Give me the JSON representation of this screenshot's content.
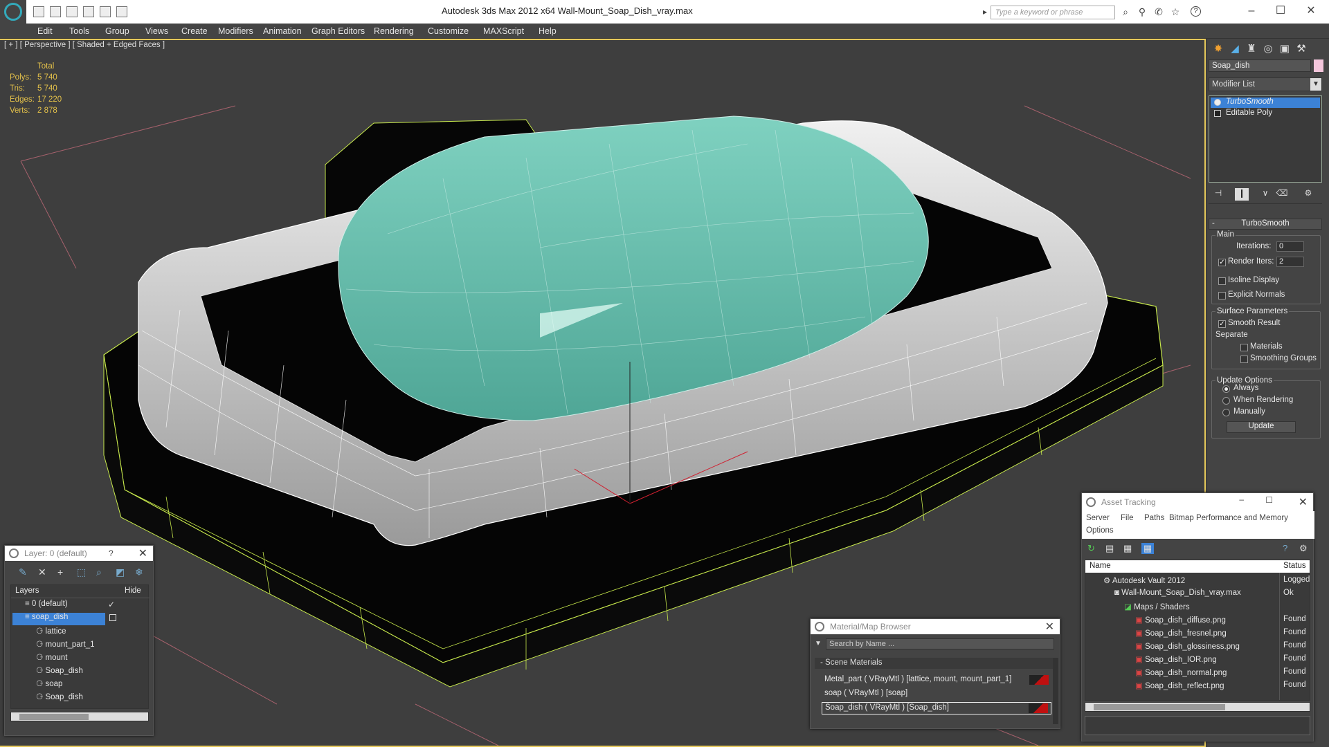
{
  "window": {
    "title": "Autodesk 3ds Max  2012 x64       Wall-Mount_Soap_Dish_vray.max",
    "search_placeholder": "Type a keyword or phrase",
    "help_icon": "?"
  },
  "menu": [
    "Edit",
    "Tools",
    "Group",
    "Views",
    "Create",
    "Modifiers",
    "Animation",
    "Graph Editors",
    "Rendering",
    "Customize",
    "MAXScript",
    "Help"
  ],
  "viewport": {
    "label": "[ + ] [ Perspective ] [ Shaded + Edged Faces ]",
    "stats": {
      "header": "Total",
      "rows": [
        {
          "label": "Polys:",
          "value": "5 740"
        },
        {
          "label": "Tris:",
          "value": "5 740"
        },
        {
          "label": "Edges:",
          "value": "17 220"
        },
        {
          "label": "Verts:",
          "value": "2 878"
        }
      ]
    }
  },
  "command_panel": {
    "object_name": "Soap_dish",
    "object_color": "#f4c6dc",
    "modifier_list": "Modifier List",
    "stack": [
      "TurboSmooth",
      "Editable Poly"
    ],
    "rollout": {
      "title": "TurboSmooth",
      "main": "Main",
      "iterations_label": "Iterations:",
      "iterations_value": "0",
      "render_iters_label": "Render Iters:",
      "render_iters_value": "2",
      "isoline": "Isoline Display",
      "explicit_normals": "Explicit Normals",
      "surface_params": "Surface Parameters",
      "smooth_result": "Smooth Result",
      "separate": "Separate",
      "materials": "Materials",
      "smoothing_groups": "Smoothing Groups",
      "update_options": "Update Options",
      "always": "Always",
      "when_rendering": "When Rendering",
      "manually": "Manually",
      "update_button": "Update"
    }
  },
  "layer_panel": {
    "title": "Layer: 0 (default)",
    "help": "?",
    "col_layers": "Layers",
    "col_hide": "Hide",
    "items": [
      {
        "name": "0 (default)",
        "indent": 1
      },
      {
        "name": "soap_dish",
        "indent": 1,
        "selected": true
      },
      {
        "name": "lattice",
        "indent": 2
      },
      {
        "name": "mount_part_1",
        "indent": 2
      },
      {
        "name": "mount",
        "indent": 2
      },
      {
        "name": "Soap_dish",
        "indent": 2
      },
      {
        "name": "soap",
        "indent": 2
      },
      {
        "name": "Soap_dish",
        "indent": 2
      }
    ]
  },
  "material_browser": {
    "title": "Material/Map Browser",
    "search": "Search by Name ...",
    "section": "Scene Materials",
    "items": [
      "Metal_part  ( VRayMtl )  [lattice, mount, mount_part_1]",
      "soap  ( VRayMtl )  [soap]",
      "Soap_dish  ( VRayMtl )  [Soap_dish]"
    ]
  },
  "asset_tracking": {
    "title": "Asset Tracking",
    "menu": [
      "Server",
      "File",
      "Paths",
      "Bitmap Performance and Memory"
    ],
    "menu2": "Options",
    "col_name": "Name",
    "col_status": "Status",
    "rows": [
      {
        "name": "Autodesk Vault 2012",
        "status": "Logged Out",
        "indent": 1
      },
      {
        "name": "Wall-Mount_Soap_Dish_vray.max",
        "status": "Ok",
        "indent": 2
      },
      {
        "name": "Maps / Shaders",
        "status": "",
        "indent": 3
      },
      {
        "name": "Soap_dish_diffuse.png",
        "status": "Found",
        "indent": 4
      },
      {
        "name": "Soap_dish_fresnel.png",
        "status": "Found",
        "indent": 4
      },
      {
        "name": "Soap_dish_glossiness.png",
        "status": "Found",
        "indent": 4
      },
      {
        "name": "Soap_dish_IOR.png",
        "status": "Found",
        "indent": 4
      },
      {
        "name": "Soap_dish_normal.png",
        "status": "Found",
        "indent": 4
      },
      {
        "name": "Soap_dish_reflect.png",
        "status": "Found",
        "indent": 4
      }
    ]
  }
}
